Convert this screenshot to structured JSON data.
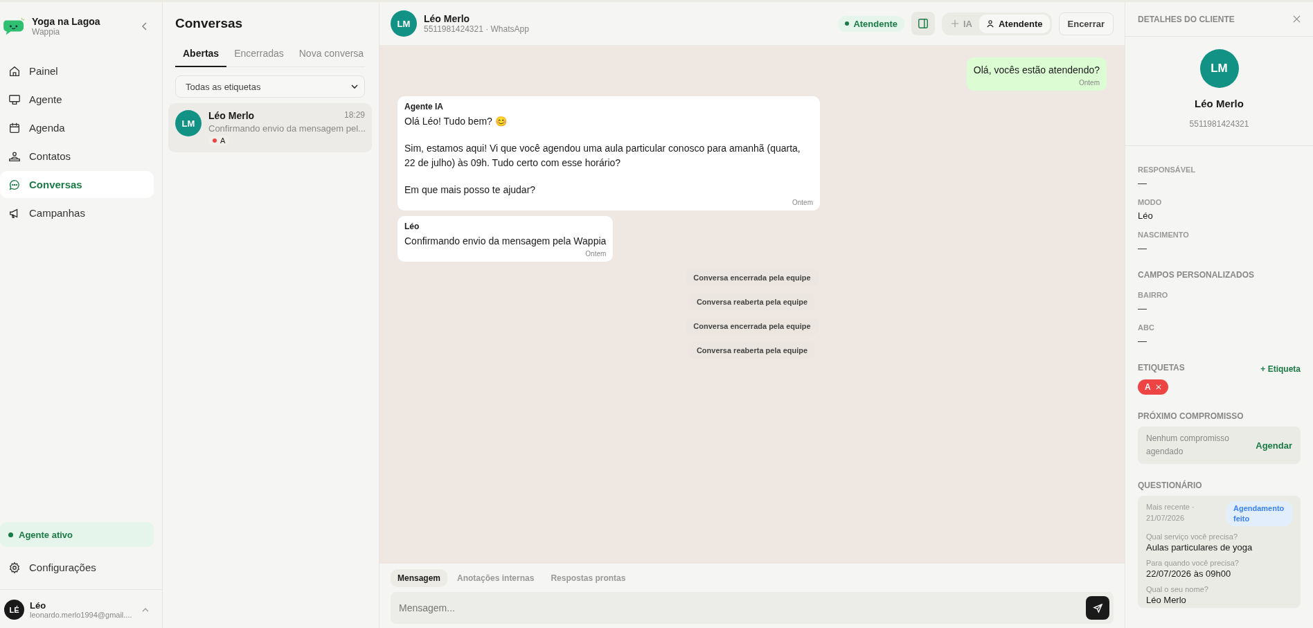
{
  "sidebar": {
    "brand": {
      "name": "Yoga na Lagoa",
      "subtitle": "Wappia"
    },
    "nav": [
      {
        "label": "Painel",
        "selected": false
      },
      {
        "label": "Agente",
        "selected": false
      },
      {
        "label": "Agenda",
        "selected": false
      },
      {
        "label": "Contatos",
        "selected": false
      },
      {
        "label": "Conversas",
        "selected": true
      },
      {
        "label": "Campanhas",
        "selected": false
      }
    ],
    "agent_status": {
      "label": "Agente ativo",
      "active": true
    },
    "settings": {
      "label": "Configurações"
    },
    "user": {
      "initials": "LÉ",
      "name": "Léo",
      "email": "leonardo.merlo1994@gmail...."
    }
  },
  "conversations": {
    "title": "Conversas",
    "tabs": [
      {
        "label": "Abertas",
        "selected": true
      },
      {
        "label": "Encerradas",
        "selected": false
      },
      {
        "label": "Nova conversa",
        "selected": false
      }
    ],
    "filter": {
      "value": "Todas as etiquetas"
    },
    "items": [
      {
        "initials": "LM",
        "name": "Léo Merlo",
        "time": "18:29",
        "preview": "Confirmando envio da mensagem pel...",
        "selected": true,
        "tags": [
          {
            "label": "A",
            "color": "#ef4444"
          }
        ]
      }
    ]
  },
  "chat": {
    "header": {
      "initials": "LM",
      "name": "Léo Merlo",
      "subtitle": "5511981424321 · WhatsApp",
      "status": "Atendente",
      "modes": [
        {
          "label": "IA",
          "selected": false
        },
        {
          "label": "Atendente",
          "selected": true
        }
      ],
      "end_button": "Encerrar"
    },
    "messages": [
      {
        "kind": "outgoing",
        "paragraphs": [
          "Olá, vocês estão atendendo?"
        ],
        "time": "Ontem"
      },
      {
        "kind": "incoming",
        "sender": "Agente IA",
        "paragraphs": [
          "Olá Léo! Tudo bem? 😊",
          "Sim, estamos aqui! Vi que você agendou uma aula particular conosco para amanhã (quarta, 22 de julho) às 09h. Tudo certo com esse horário?",
          "Em que mais posso te ajudar?"
        ],
        "time": "Ontem"
      },
      {
        "kind": "incoming",
        "sender": "Léo",
        "paragraphs": [
          "Confirmando envio da mensagem pela Wappia"
        ],
        "time": "Ontem"
      },
      {
        "kind": "event",
        "paragraphs": [
          "Conversa encerrada pela equipe"
        ]
      },
      {
        "kind": "event",
        "paragraphs": [
          "Conversa reaberta pela equipe"
        ]
      },
      {
        "kind": "event",
        "paragraphs": [
          "Conversa encerrada pela equipe"
        ]
      },
      {
        "kind": "event",
        "paragraphs": [
          "Conversa reaberta pela equipe"
        ]
      }
    ],
    "composer": {
      "tabs": [
        {
          "label": "Mensagem",
          "selected": true
        },
        {
          "label": "Anotações internas",
          "selected": false
        },
        {
          "label": "Respostas prontas",
          "selected": false
        }
      ],
      "placeholder": "Mensagem..."
    }
  },
  "details": {
    "title": "DETALHES DO CLIENTE",
    "initials": "LM",
    "name": "Léo Merlo",
    "phone": "5511981424321",
    "fields": [
      {
        "label": "RESPONSÁVEL",
        "value": "—"
      },
      {
        "label": "MODO",
        "value": "Léo"
      },
      {
        "label": "NASCIMENTO",
        "value": "—"
      }
    ],
    "custom_title": "CAMPOS PERSONALIZADOS",
    "custom_fields": [
      {
        "label": "BAIRRO",
        "value": "—"
      },
      {
        "label": "ABC",
        "value": "—"
      }
    ],
    "tags_title": "ETIQUETAS",
    "add_tag": "+ Etiqueta",
    "tags": [
      {
        "label": "A",
        "color": "#ef4444"
      }
    ],
    "appointment_title": "PRÓXIMO COMPROMISSO",
    "appointment_empty": "Nenhum compromisso agendado",
    "appointment_action": "Agendar",
    "questionnaire_title": "QUESTIONÁRIO",
    "questionnaire": {
      "meta": "Mais recente · 21/07/2026",
      "badge": "Agendamento feito",
      "answers": [
        {
          "question": "Qual serviço você precisa?",
          "answer": "Aulas particulares de yoga"
        },
        {
          "question": "Para quando você precisa?",
          "answer": "22/07/2026 às 09h00"
        },
        {
          "question": "Qual o seu nome?",
          "answer": "Léo Merlo"
        }
      ]
    }
  }
}
